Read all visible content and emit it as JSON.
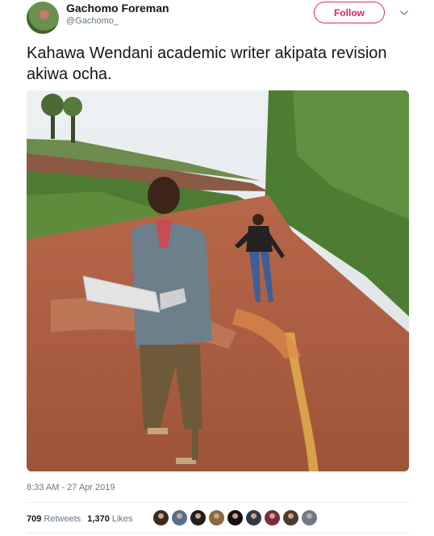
{
  "header": {
    "display_name": "Gachomo Foreman",
    "handle": "@Gachomo_",
    "follow_label": "Follow",
    "caret_icon": "chevron-down-icon",
    "accent_color": "#e0245e"
  },
  "tweet": {
    "text": "Kahawa Wendani academic writer akipata revision akiwa ocha.",
    "timestamp": "8:33 AM - 27 Apr 2019"
  },
  "stats": {
    "retweets_count": "709",
    "retweets_label": "Retweets",
    "likes_count": "1,370",
    "likes_label": "Likes"
  },
  "likers": [
    {
      "color": "#3a2a22"
    },
    {
      "color": "#56708c"
    },
    {
      "color": "#1f1f1f"
    },
    {
      "color": "#8a6a3a"
    },
    {
      "color": "#111111"
    },
    {
      "color": "#2f3a48"
    },
    {
      "color": "#7a2b3c"
    },
    {
      "color": "#4a3b2c"
    },
    {
      "color": "#6b7a8a"
    }
  ]
}
